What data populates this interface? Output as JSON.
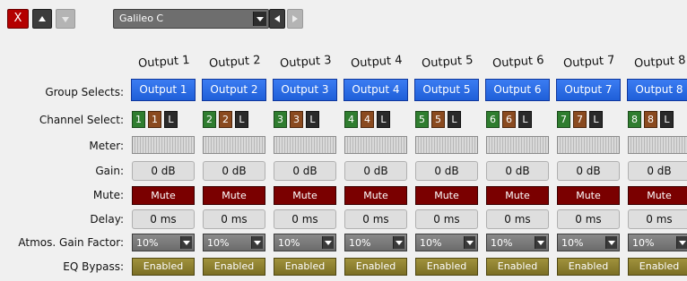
{
  "toolbar": {
    "close_label": "X",
    "preset": "Galileo C"
  },
  "labels": {
    "group_selects": "Group Selects:",
    "channel_select": "Channel Select:",
    "meter": "Meter:",
    "gain": "Gain:",
    "mute": "Mute:",
    "delay": "Delay:",
    "atmos_gain": "Atmos. Gain Factor:",
    "eq_bypass": "EQ Bypass:"
  },
  "outputs": [
    {
      "header": "Output 1",
      "group": "Output 1",
      "ch": "1",
      "ch2": "1",
      "link": "L",
      "gain": "0 dB",
      "mute": "Mute",
      "delay": "0 ms",
      "atmos": "10%",
      "eq": "Enabled"
    },
    {
      "header": "Output 2",
      "group": "Output 2",
      "ch": "2",
      "ch2": "2",
      "link": "L",
      "gain": "0 dB",
      "mute": "Mute",
      "delay": "0 ms",
      "atmos": "10%",
      "eq": "Enabled"
    },
    {
      "header": "Output 3",
      "group": "Output 3",
      "ch": "3",
      "ch2": "3",
      "link": "L",
      "gain": "0 dB",
      "mute": "Mute",
      "delay": "0 ms",
      "atmos": "10%",
      "eq": "Enabled"
    },
    {
      "header": "Output 4",
      "group": "Output 4",
      "ch": "4",
      "ch2": "4",
      "link": "L",
      "gain": "0 dB",
      "mute": "Mute",
      "delay": "0 ms",
      "atmos": "10%",
      "eq": "Enabled"
    },
    {
      "header": "Output 5",
      "group": "Output 5",
      "ch": "5",
      "ch2": "5",
      "link": "L",
      "gain": "0 dB",
      "mute": "Mute",
      "delay": "0 ms",
      "atmos": "10%",
      "eq": "Enabled"
    },
    {
      "header": "Output 6",
      "group": "Output 6",
      "ch": "6",
      "ch2": "6",
      "link": "L",
      "gain": "0 dB",
      "mute": "Mute",
      "delay": "0 ms",
      "atmos": "10%",
      "eq": "Enabled"
    },
    {
      "header": "Output 7",
      "group": "Output 7",
      "ch": "7",
      "ch2": "7",
      "link": "L",
      "gain": "0 dB",
      "mute": "Mute",
      "delay": "0 ms",
      "atmos": "10%",
      "eq": "Enabled"
    },
    {
      "header": "Output 8",
      "group": "Output 8",
      "ch": "8",
      "ch2": "8",
      "link": "L",
      "gain": "0 dB",
      "mute": "Mute",
      "delay": "0 ms",
      "atmos": "10%",
      "eq": "Enabled"
    }
  ],
  "colors": {
    "group_blue": "#2a6ae6",
    "mute_red": "#7a0000",
    "eq_olive": "#8c7f30",
    "close_red": "#b40000"
  }
}
